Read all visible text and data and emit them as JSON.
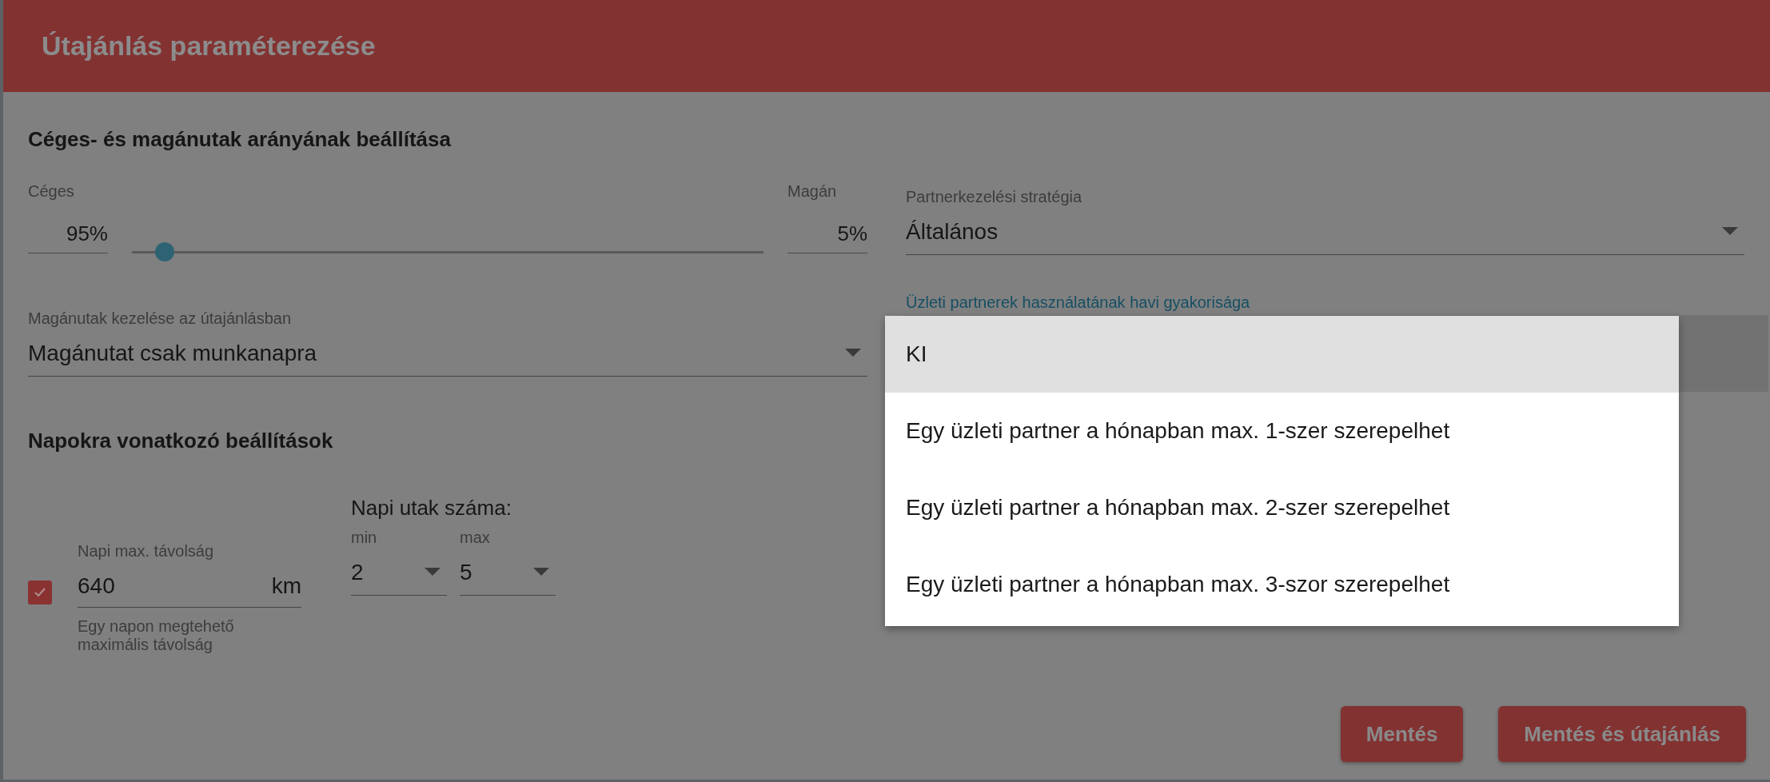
{
  "dialog": {
    "title": "Útajánlás paraméterezése"
  },
  "ratio_section": {
    "heading": "Céges- és magánutak arányának beállítása",
    "company": {
      "label": "Céges",
      "value": "95%"
    },
    "private": {
      "label": "Magán",
      "value": "5%"
    },
    "slider": {
      "level": 0.05
    }
  },
  "partner_strategy": {
    "label": "Partnerkezelési stratégia",
    "value": "Általános"
  },
  "private_trips": {
    "label": "Magánutak kezelése az útajánlásban",
    "value": "Magánutat csak munkanapra"
  },
  "partner_frequency": {
    "label": "Üzleti partnerek használatának havi gyakorisága",
    "expanded": true,
    "options": [
      {
        "label": "KI",
        "selected": true
      },
      {
        "label": "Egy üzleti partner a hónapban max. 1-szer szerepelhet",
        "selected": false
      },
      {
        "label": "Egy üzleti partner a hónapban max. 2-szer szerepelhet",
        "selected": false
      },
      {
        "label": "Egy üzleti partner a hónapban max. 3-szor szerepelhet",
        "selected": false
      }
    ]
  },
  "days_section": {
    "heading": "Napokra vonatkozó beállítások",
    "max_distance": {
      "enabled": true,
      "label": "Napi max. távolság",
      "value": "640",
      "unit": "km",
      "hint": "Egy napon megtehető maximális távolság"
    },
    "trips": {
      "heading": "Napi utak száma:",
      "min": {
        "label": "min",
        "value": "2"
      },
      "max": {
        "label": "max",
        "value": "5"
      }
    }
  },
  "buttons": [
    {
      "label": "Mentés"
    },
    {
      "label": "Mentés és útajánlás"
    }
  ]
}
